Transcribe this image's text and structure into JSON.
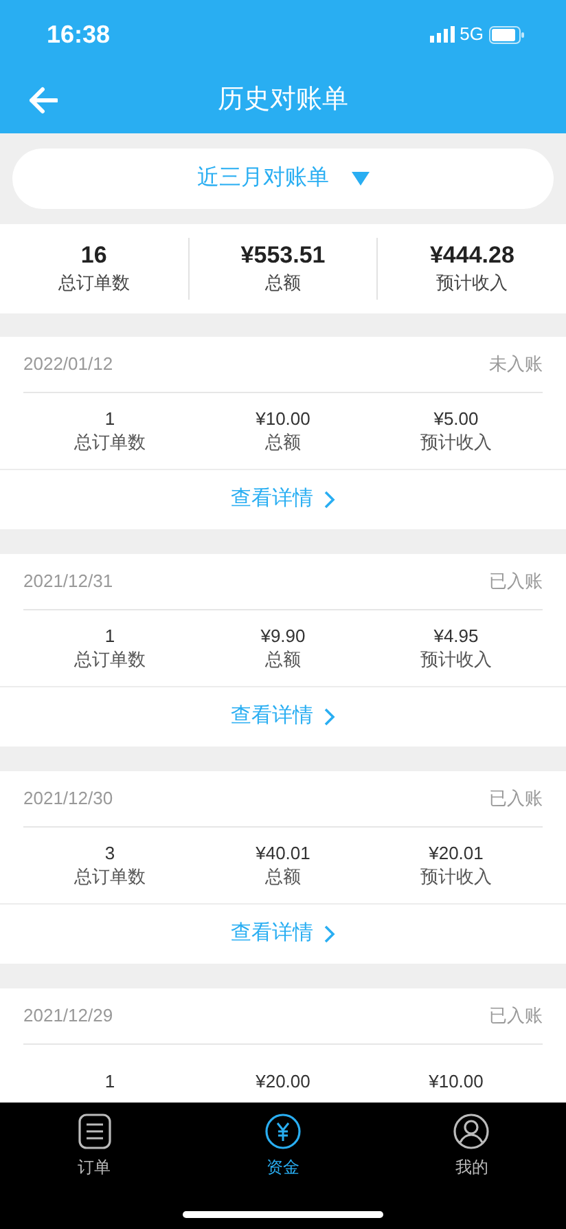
{
  "status_bar": {
    "time": "16:38",
    "network": "5G"
  },
  "header": {
    "title": "历史对账单"
  },
  "filter": {
    "label": "近三月对账单"
  },
  "summary": [
    {
      "value": "16",
      "label": "总订单数"
    },
    {
      "value": "¥553.51",
      "label": "总额"
    },
    {
      "value": "¥444.28",
      "label": "预计收入"
    }
  ],
  "bills": [
    {
      "date": "2022/01/12",
      "status": "未入账",
      "stats": [
        {
          "value": "1",
          "label": "总订单数"
        },
        {
          "value": "¥10.00",
          "label": "总额"
        },
        {
          "value": "¥5.00",
          "label": "预计收入"
        }
      ],
      "details_link": "查看详情"
    },
    {
      "date": "2021/12/31",
      "status": "已入账",
      "stats": [
        {
          "value": "1",
          "label": "总订单数"
        },
        {
          "value": "¥9.90",
          "label": "总额"
        },
        {
          "value": "¥4.95",
          "label": "预计收入"
        }
      ],
      "details_link": "查看详情"
    },
    {
      "date": "2021/12/30",
      "status": "已入账",
      "stats": [
        {
          "value": "3",
          "label": "总订单数"
        },
        {
          "value": "¥40.01",
          "label": "总额"
        },
        {
          "value": "¥20.01",
          "label": "预计收入"
        }
      ],
      "details_link": "查看详情"
    },
    {
      "date": "2021/12/29",
      "status": "已入账",
      "stats": [
        {
          "value": "1"
        },
        {
          "value": "¥20.00"
        },
        {
          "value": "¥10.00"
        }
      ]
    }
  ],
  "tab_bar": [
    {
      "label": "订单",
      "kind": "list",
      "selected": false
    },
    {
      "label": "资金",
      "kind": "yuan",
      "selected": true
    },
    {
      "label": "我的",
      "kind": "person",
      "selected": false
    }
  ]
}
